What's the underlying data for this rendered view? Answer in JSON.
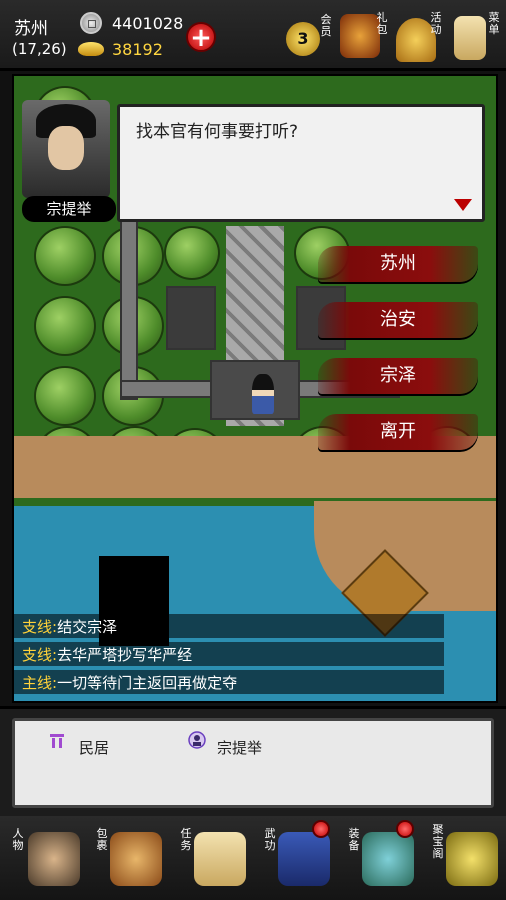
{
  "top_bar": {
    "location_name": "苏州",
    "coordinates": "(17,26)",
    "silver": "4401028",
    "gold": "38192",
    "vip_level": "3",
    "menu_labels": {
      "member": "会员",
      "gift": "礼包",
      "activity": "活动",
      "menu": "菜单"
    }
  },
  "dialog": {
    "speaker": "宗提举",
    "text": "找本官有何事要打听?",
    "options": [
      "苏州",
      "治安",
      "宗泽",
      "离开"
    ]
  },
  "quests": [
    {
      "tag": "支线:",
      "text": "结交宗泽"
    },
    {
      "tag": "支线:",
      "text": "去华严塔抄写华严经"
    },
    {
      "tag": "主线:",
      "text": "一切等待门主返回再做定夺"
    }
  ],
  "info_panel": {
    "items": [
      "民居",
      "宗提举"
    ]
  },
  "bottom_nav": {
    "character": "人物",
    "bag": "包裹",
    "task": "任务",
    "martial": "武功",
    "equipment": "装备",
    "treasure": "聚宝阁"
  },
  "colors": {
    "accent_red": "#8b0d0d",
    "quest_tag": "#ffd23a",
    "grass": "#2d6a1d",
    "water": "#2c8fb1"
  }
}
